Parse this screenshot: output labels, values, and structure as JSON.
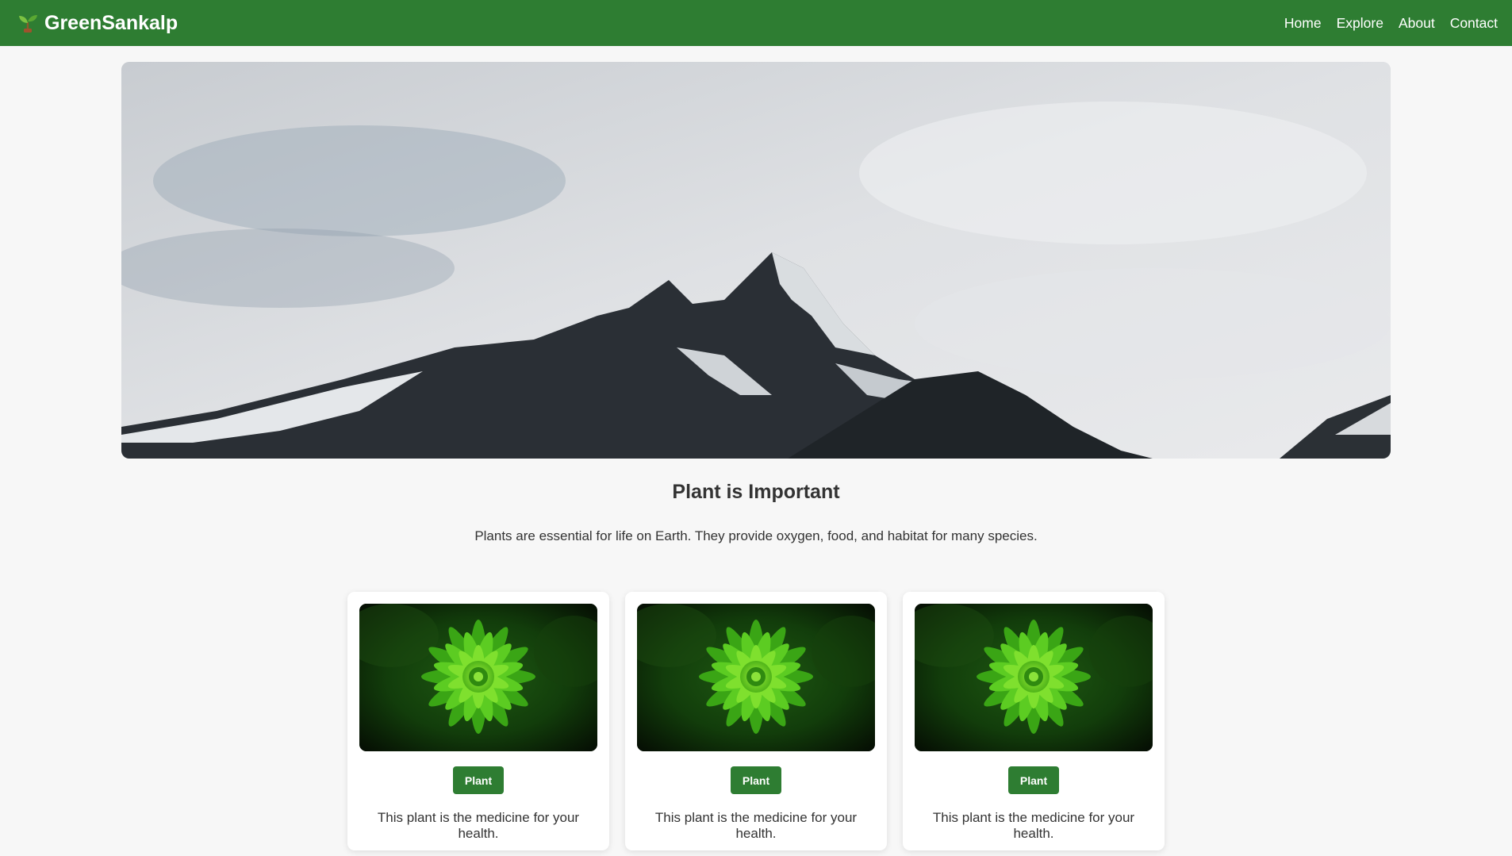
{
  "navbar": {
    "brand": "GreenSankalp",
    "brand_icon": "seedling-icon",
    "links": [
      {
        "label": "Home"
      },
      {
        "label": "Explore"
      },
      {
        "label": "About"
      },
      {
        "label": "Contact"
      }
    ]
  },
  "hero": {
    "image": "mountain-peak-image"
  },
  "section": {
    "title": "Plant is Important",
    "text": "Plants are essential for life on Earth. They provide oxygen, food, and habitat for many species."
  },
  "cards": [
    {
      "button_label": "Plant",
      "text": "This plant is the medicine for your health.",
      "image": "green-plant-image"
    },
    {
      "button_label": "Plant",
      "text": "This plant is the medicine for your health.",
      "image": "green-plant-image"
    },
    {
      "button_label": "Plant",
      "text": "This plant is the medicine for your health.",
      "image": "green-plant-image"
    }
  ],
  "colors": {
    "navbar": "#2e7d32",
    "button": "#2e7d32",
    "background": "#f7f7f7",
    "text": "#333333"
  }
}
